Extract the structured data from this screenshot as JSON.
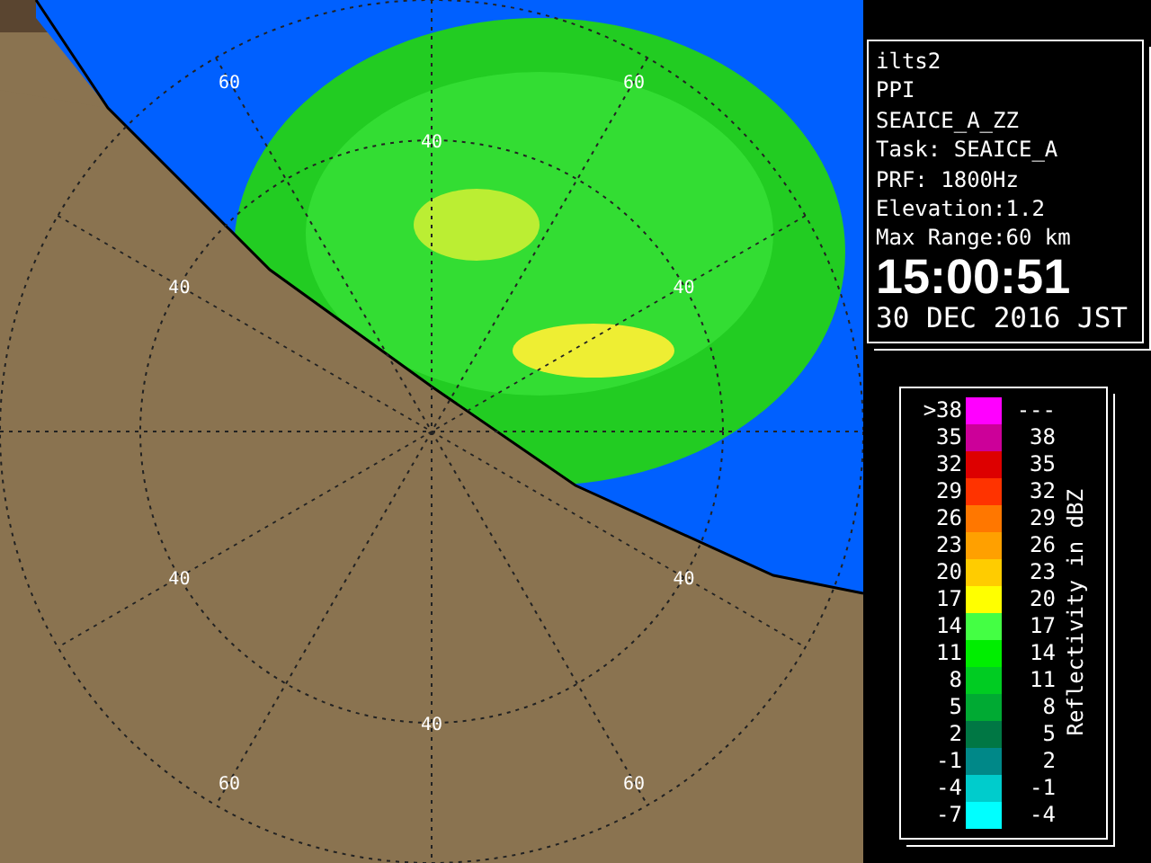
{
  "map": {
    "range_labels": [
      "60",
      "60",
      "40",
      "40",
      "40",
      "40",
      "40",
      "40",
      "60",
      "60"
    ]
  },
  "info": {
    "lines": [
      "ilts2",
      "PPI",
      "SEAICE_A_ZZ",
      "Task: SEAICE_A",
      "PRF: 1800Hz",
      "Elevation:1.2",
      "Max Range:60 km"
    ],
    "time": "15:00:51",
    "date": "30 DEC 2016 JST"
  },
  "legend": {
    "title": "Reflectivity in dBZ",
    "rows": [
      {
        "low": ">38",
        "high": "---",
        "color": "#ff00ff"
      },
      {
        "low": "35",
        "high": "38",
        "color": "#cc0099"
      },
      {
        "low": "32",
        "high": "35",
        "color": "#dd0000"
      },
      {
        "low": "29",
        "high": "32",
        "color": "#ff3300"
      },
      {
        "low": "26",
        "high": "29",
        "color": "#ff7700"
      },
      {
        "low": "23",
        "high": "26",
        "color": "#ffa000"
      },
      {
        "low": "20",
        "high": "23",
        "color": "#ffcc00"
      },
      {
        "low": "17",
        "high": "20",
        "color": "#ffff00"
      },
      {
        "low": "14",
        "high": "17",
        "color": "#44ff44"
      },
      {
        "low": "11",
        "high": "14",
        "color": "#00ee00"
      },
      {
        "low": "8",
        "high": "11",
        "color": "#00cc22"
      },
      {
        "low": "5",
        "high": "8",
        "color": "#00aa33"
      },
      {
        "low": "2",
        "high": "5",
        "color": "#007744"
      },
      {
        "low": "-1",
        "high": "2",
        "color": "#008888"
      },
      {
        "low": "-4",
        "high": "-1",
        "color": "#00cccc"
      },
      {
        "low": "-7",
        "high": "-4",
        "color": "#00ffff"
      }
    ]
  }
}
